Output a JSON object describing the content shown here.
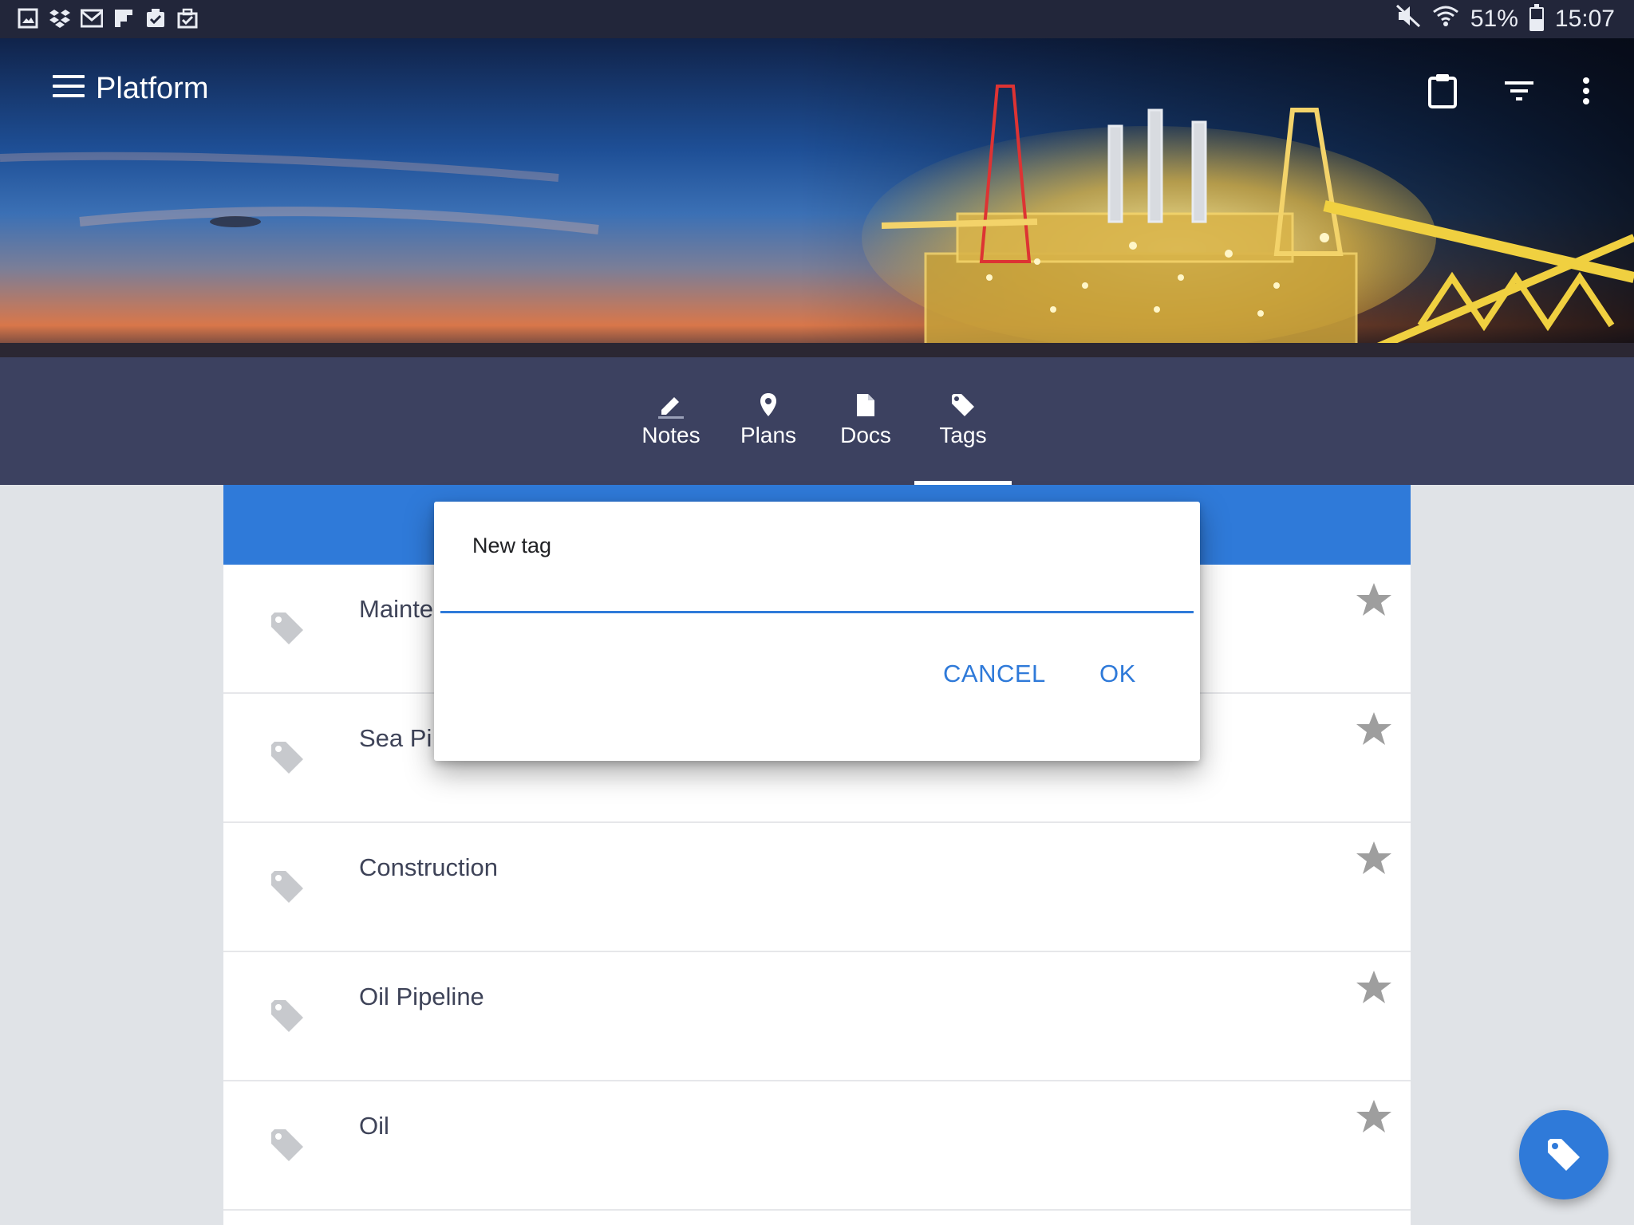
{
  "status_bar": {
    "notification_icons": [
      "gallery-icon",
      "dropbox-icon",
      "mail-icon",
      "flipboard-icon",
      "clipboard-check-icon",
      "briefcase-check-icon"
    ],
    "battery": "51%",
    "battery_level": 0.51,
    "time": "15:07"
  },
  "toolbar": {
    "title": "Platform",
    "actions": [
      "clipboard-icon",
      "filter-icon",
      "more-vert-icon"
    ]
  },
  "tabs": [
    {
      "label": "Notes",
      "icon": "pencil-icon"
    },
    {
      "label": "Plans",
      "icon": "location-pin-icon"
    },
    {
      "label": "Docs",
      "icon": "document-icon"
    },
    {
      "label": "Tags",
      "icon": "tag-icon",
      "active": true
    }
  ],
  "tags_list": [
    {
      "label": "Mainte"
    },
    {
      "label": "Sea Pi"
    },
    {
      "label": "Construction"
    },
    {
      "label": "Oil Pipeline"
    },
    {
      "label": "Oil"
    }
  ],
  "dialog": {
    "title": "New tag",
    "input_value": "",
    "cancel_label": "CANCEL",
    "ok_label": "OK"
  },
  "fab": {
    "icon": "tag-icon"
  },
  "colors": {
    "accent": "#2f7ad9",
    "tabs_bar": "#3c4160",
    "status_bar": "#22263a",
    "icon_grey": "#c7c9cd",
    "star_grey": "#9e9e9e"
  }
}
